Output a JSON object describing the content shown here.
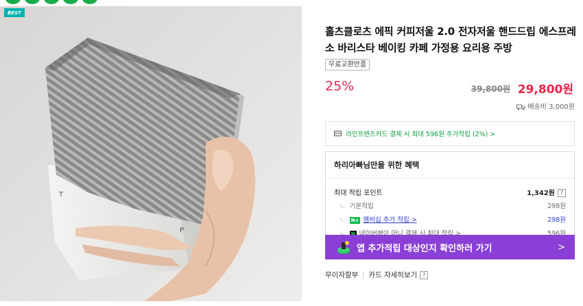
{
  "badge": "BEST",
  "product": {
    "title": "홀츠클로츠 에픽 커피저울 2.0 전자저울 핸드드립 에스프레소 바리스타 베이킹 카페 가정용 요리용 주방",
    "tag": "무료교환반품",
    "discount": "25%",
    "original_price": "39,800원",
    "sale_price": "29,800원",
    "shipping": "배송비 3,000원"
  },
  "card_benefit": "라인프렌즈카드 결제 시 최대 596원 추가적립 (2%) >",
  "benefit": {
    "heading": "하리아빠님만을 위한 혜택",
    "max_label": "최대 적립 포인트",
    "max_value": "1,342원",
    "qmark": "?",
    "rows": [
      {
        "label": "기본적립",
        "value": "298원"
      },
      {
        "badge": "N+",
        "label": "멤버십 추가 적립 >",
        "value": "298원"
      },
      {
        "badge": "N",
        "label": "네이버페이 머니 결제 시 최대 적립 >",
        "value": "596원"
      }
    ],
    "tree_glyph": "ㄴ"
  },
  "app_banner": {
    "text": "앱 추가적립 대상인지 확인하러 가기",
    "arrow": ">"
  },
  "installment": {
    "label": "무이자할부",
    "card_link": "카드 자세히보기",
    "qmark": "?"
  },
  "colors": {
    "accent_red": "#e8274b",
    "green": "#0d9e3e",
    "purple": "#8a3fd6",
    "badge_teal": "#00b3b0"
  }
}
